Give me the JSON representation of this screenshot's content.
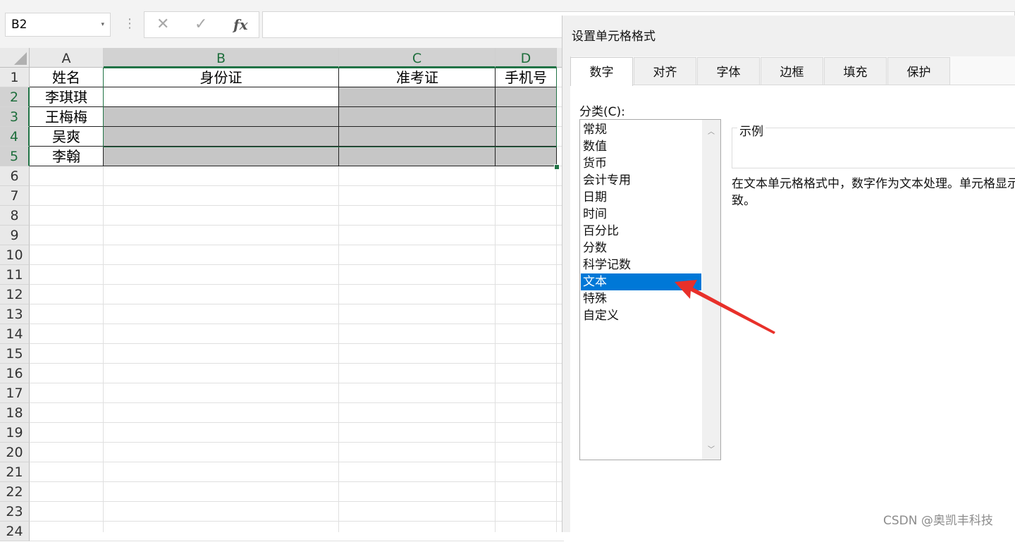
{
  "formula_bar": {
    "name_box": "B2",
    "dropdown_glyph": "▾",
    "separator_glyph": "⋮",
    "cancel_glyph": "✕",
    "enter_glyph": "✓",
    "fx_label": "fx",
    "formula_value": ""
  },
  "sheet": {
    "columns": [
      "A",
      "B",
      "C",
      "D"
    ],
    "rows": [
      "1",
      "2",
      "3",
      "4",
      "5",
      "6",
      "7",
      "8",
      "9",
      "10",
      "11",
      "12",
      "13",
      "14",
      "15",
      "16",
      "17",
      "18",
      "19",
      "20",
      "21",
      "22",
      "23",
      "24"
    ],
    "header_row": [
      "姓名",
      "身份证",
      "准考证",
      "手机号"
    ],
    "names": [
      "李琪琪",
      "王梅梅",
      "吴爽",
      "李翰"
    ],
    "selected_range": "B2:D5"
  },
  "dialog": {
    "title": "设置单元格格式",
    "tabs": [
      "数字",
      "对齐",
      "字体",
      "边框",
      "填充",
      "保护"
    ],
    "active_tab": "数字",
    "category_label": "分类(C):",
    "categories": [
      "常规",
      "数值",
      "货币",
      "会计专用",
      "日期",
      "时间",
      "百分比",
      "分数",
      "科学记数",
      "文本",
      "特殊",
      "自定义"
    ],
    "selected_category": "文本",
    "sample_label": "示例",
    "description_line1": "在文本单元格格式中，数字作为文本处理。单元格显示的内容与输入的内容完全一",
    "description_line2": "致。"
  },
  "annotation": {
    "arrow_color": "#e8302a"
  },
  "watermark": "CSDN @奥凯丰科技",
  "colors": {
    "accent": "#217346",
    "selection": "#0078d7",
    "shade": "#c6c6c6"
  }
}
